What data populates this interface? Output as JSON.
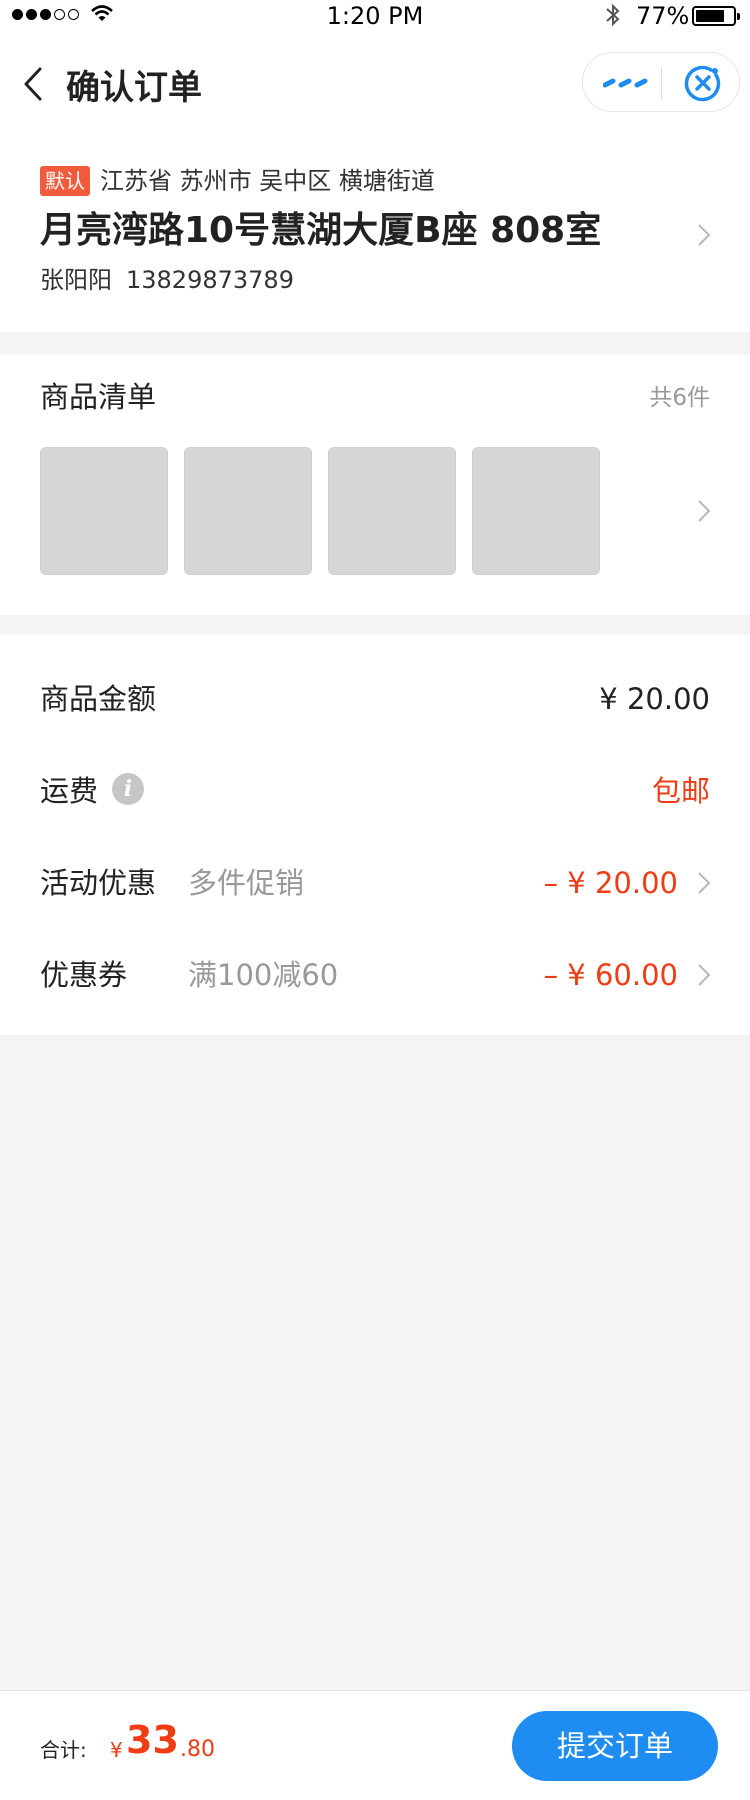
{
  "status_bar": {
    "time": "1:20 PM",
    "battery_percent": "77%",
    "battery_level": 0.77,
    "signal_bars": 3,
    "signal_total": 5,
    "icons": [
      "signal-dots-icon",
      "wifi-icon",
      "bluetooth-icon",
      "battery-icon"
    ]
  },
  "nav": {
    "title": "确认订单",
    "back_icon": "chevron-left-icon",
    "more_icon": "more-dots-icon",
    "close_icon": "close-circle-icon",
    "accent_color": "#1e8cf0"
  },
  "address": {
    "badge": "默认",
    "region": "江苏省 苏州市 吴中区 横塘街道",
    "street": "月亮湾路10号慧湖大厦B座 808室",
    "name": "张阳阳",
    "phone": "13829873789"
  },
  "goods": {
    "title": "商品清单",
    "count": "共6件",
    "visible_thumbnails": 4
  },
  "prices": {
    "items": [
      {
        "label": "商品金额",
        "sub": "",
        "value": "¥ 20.00",
        "red": false,
        "arrow": false
      },
      {
        "label": "运费",
        "sub": "",
        "value": "包邮",
        "red": true,
        "arrow": false,
        "info_icon": "info-icon"
      },
      {
        "label": "活动优惠",
        "sub": "多件促销",
        "value": "– ¥ 20.00",
        "red": true,
        "arrow": true
      },
      {
        "label": "优惠券",
        "sub": "满100减60",
        "value": "– ¥ 60.00",
        "red": true,
        "arrow": true
      }
    ]
  },
  "bottom": {
    "total_label": "合计:",
    "currency": "¥",
    "total_int": "33",
    "total_dec": ".80",
    "submit_label": "提交订单",
    "price_color": "#f03c14"
  }
}
